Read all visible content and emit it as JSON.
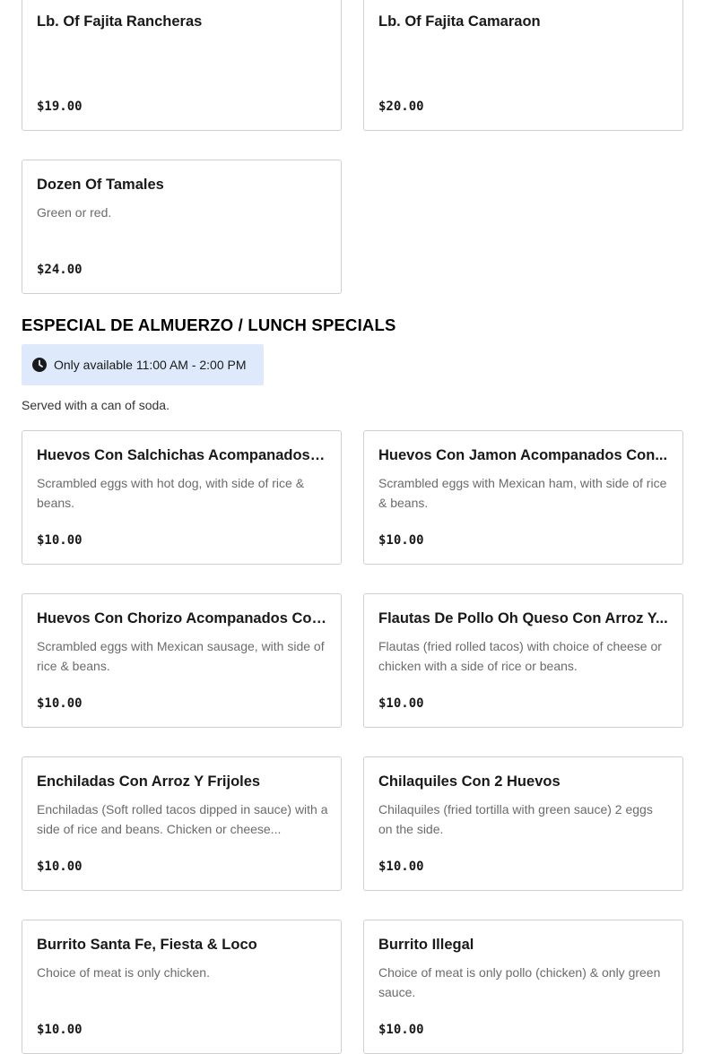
{
  "top_items": [
    {
      "name": "Lb. Of Fajita Rancheras",
      "desc": "",
      "price": "$19.00"
    },
    {
      "name": "Lb. Of Fajita Camaraon",
      "desc": "",
      "price": "$20.00"
    },
    {
      "name": "Dozen Of Tamales",
      "desc": "Green or red.",
      "price": "$24.00"
    }
  ],
  "lunch": {
    "title": "ESPECIAL DE ALMUERZO / LUNCH SPECIALS",
    "hours": "Only available 11:00 AM - 2:00 PM",
    "note": "Served with a can of soda.",
    "items": [
      {
        "name": "Huevos Con Salchichas Acompanados Co...",
        "desc": "Scrambled eggs with hot dog, with side of rice & beans.",
        "price": "$10.00"
      },
      {
        "name": "Huevos Con Jamon Acompanados Con...",
        "desc": "Scrambled eggs with Mexican ham, with side of rice & beans.",
        "price": "$10.00"
      },
      {
        "name": "Huevos Con Chorizo Acompanados Con...",
        "desc": "Scrambled eggs with Mexican sausage, with side of rice & beans.",
        "price": "$10.00"
      },
      {
        "name": "Flautas De Pollo Oh Queso Con Arroz Y...",
        "desc": "Flautas (fried rolled tacos) with choice of cheese or chicken with a side of rice or beans.",
        "price": "$10.00"
      },
      {
        "name": "Enchiladas Con Arroz Y Frijoles",
        "desc": "Enchiladas (Soft rolled tacos dipped in sauce) with a side of rice and beans. Chicken or cheese...",
        "price": "$10.00"
      },
      {
        "name": "Chilaquiles Con 2 Huevos",
        "desc": "Chilaquiles (fried tortilla with green sauce) 2 eggs on the side.",
        "price": "$10.00"
      },
      {
        "name": "Burrito Santa Fe, Fiesta & Loco",
        "desc": "Choice of meat is only chicken.",
        "price": "$10.00"
      },
      {
        "name": "Burrito Illegal",
        "desc": "Choice of meat is only pollo (chicken) & only green sauce.",
        "price": "$10.00"
      }
    ]
  }
}
